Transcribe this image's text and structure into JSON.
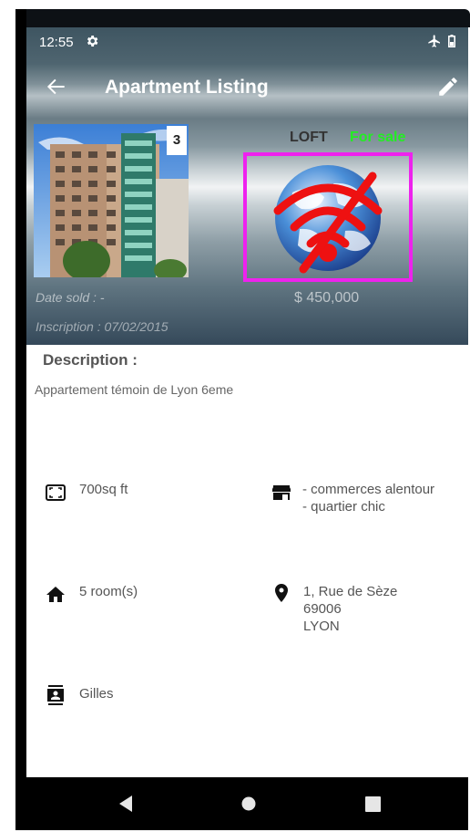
{
  "status_bar": {
    "time": "12:55"
  },
  "app_bar": {
    "title": "Apartment Listing"
  },
  "listing": {
    "photo_count": "3",
    "type": "LOFT",
    "status": "For sale",
    "date_sold": "Date sold : -",
    "price": "$ 450,000",
    "inscription": "Inscription : 07/02/2015"
  },
  "description": {
    "heading": "Description :",
    "text": "Appartement témoin de Lyon 6eme"
  },
  "features": {
    "surface": "700sq ft",
    "nearby_line1": "- commerces alentour",
    "nearby_line2": "- quartier chic",
    "rooms": "5 room(s)",
    "address_line1": "1, Rue de Sèze",
    "address_line2": "69006",
    "address_line3": "LYON",
    "agent": "Gilles"
  },
  "colors": {
    "status_green": "#22ee22",
    "highlight_magenta": "#ee22ee",
    "header_blue_gray": "#3e5561"
  }
}
